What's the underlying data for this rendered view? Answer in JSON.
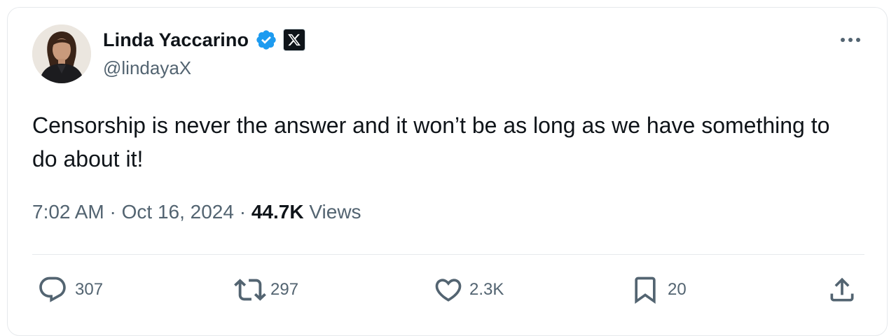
{
  "author": {
    "display_name": "Linda Yaccarino",
    "handle": "@lindayaX",
    "verified_icon": "verified-badge-icon",
    "affiliation_icon": "x-logo-icon"
  },
  "tweet": {
    "text": "Censorship is never the answer and it won’t be as long as we have something to do about it!",
    "time": "7:02 AM",
    "separator": "·",
    "date": "Oct 16, 2024",
    "views_count": "44.7K",
    "views_label": "Views"
  },
  "actions": {
    "reply": {
      "icon": "reply-icon",
      "count": "307"
    },
    "retweet": {
      "icon": "retweet-icon",
      "count": "297"
    },
    "like": {
      "icon": "heart-icon",
      "count": "2.3K"
    },
    "bookmark": {
      "icon": "bookmark-icon",
      "count": "20"
    },
    "share": {
      "icon": "share-icon"
    }
  },
  "colors": {
    "text_primary": "#0f1419",
    "text_secondary": "#536471",
    "verified_blue": "#1d9bf0",
    "border": "#e6e9ec"
  }
}
